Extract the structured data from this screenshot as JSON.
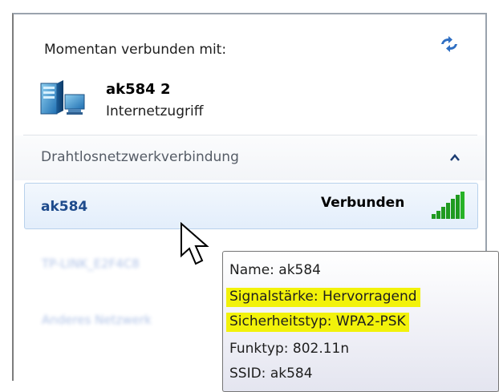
{
  "status": {
    "currently_connected_label": "Momentan verbunden mit:",
    "network_name": "ak584  2",
    "network_access": "Internetzugriff"
  },
  "section": {
    "label": "Drahtlosnetzwerkverbindung"
  },
  "networks": [
    {
      "name": "ak584",
      "status": "Verbunden",
      "signal_level": 5,
      "signal_max": 5
    }
  ],
  "blurred_networks": [
    "TP-LINK_E2F4C8",
    "Anderes Netzwerk"
  ],
  "tooltip": {
    "name": "Name: ak584",
    "signal": "Signalstärke: Hervorragend",
    "security": "Sicherheitstyp: WPA2-PSK",
    "radio_type": "Funktyp: 802.11n",
    "ssid": "SSID: ak584"
  },
  "colors": {
    "highlight": "#f2f20a",
    "signal_green": "#1f9a1f",
    "link_blue": "#1e4b8c"
  },
  "icons": {
    "refresh": "refresh-arrows-icon",
    "network": "network-computer-icon",
    "collapse": "chevron-up-icon",
    "signal": "signal-bars-icon",
    "cursor": "mouse-pointer-icon"
  }
}
